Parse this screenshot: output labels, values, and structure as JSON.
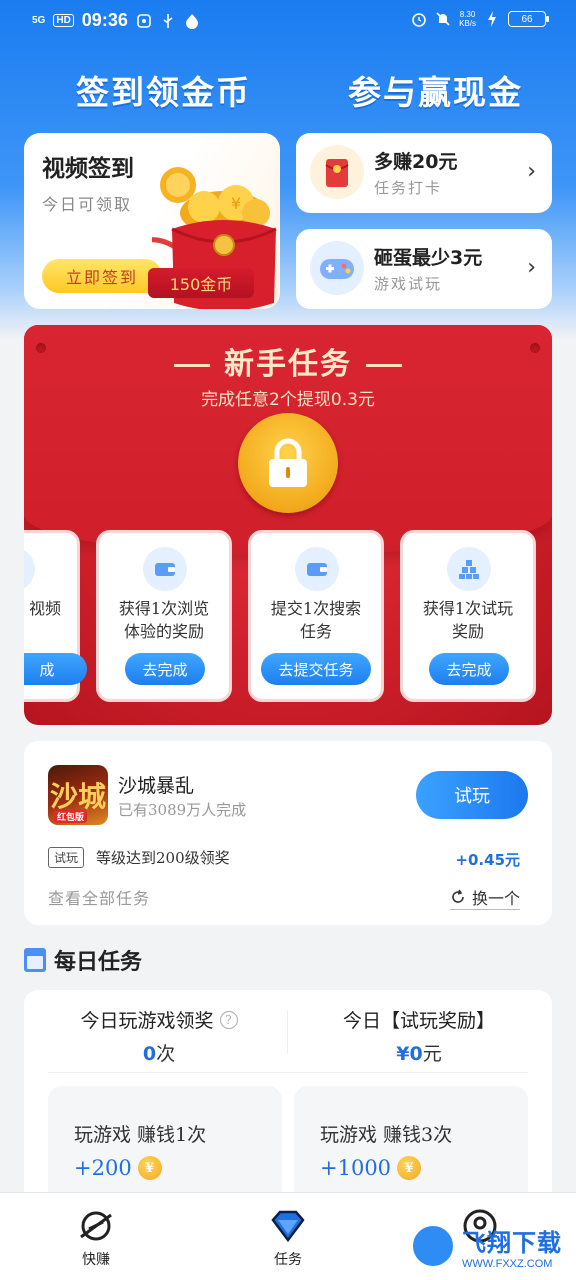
{
  "status_bar": {
    "network": "5G",
    "hd": "HD",
    "time": "09:36",
    "speed_value": "8.30",
    "speed_unit": "KB/s",
    "battery": "66"
  },
  "hero": {
    "left_title": "签到领金币",
    "right_title": "参与赢现金"
  },
  "signin_card": {
    "title": "视频签到",
    "subtitle": "今日可领取",
    "button": "立即签到",
    "badge": "150金币"
  },
  "side_cards": [
    {
      "title": "多赚20元",
      "subtitle": "任务打卡"
    },
    {
      "title": "砸蛋最少3元",
      "subtitle": "游戏试玩"
    }
  ],
  "newbie": {
    "title": "新手任务",
    "subtitle": "完成任意2个提现0.3元",
    "tasks": [
      {
        "line1": "",
        "line2": "视频",
        "button": "成"
      },
      {
        "line1": "获得1次浏览",
        "line2": "体验的奖励",
        "button": "去完成"
      },
      {
        "line1": "提交1次搜索",
        "line2": "任务",
        "button": "去提交任务"
      },
      {
        "line1": "获得1次试玩",
        "line2": "奖励",
        "button": "去完成"
      }
    ]
  },
  "game": {
    "icon_text": "沙城",
    "icon_tag": "红包版",
    "name": "沙城暴乱",
    "completed": "已有3089万人完成",
    "try_button": "试玩",
    "trial_tag": "试玩",
    "trial_desc": "等级达到200级领奖",
    "trial_reward": "+0.45元",
    "view_all": "查看全部任务",
    "swap": "换一个"
  },
  "daily": {
    "title": "每日任务",
    "stat_left_label": "今日玩游戏领奖",
    "stat_left_value": "0",
    "stat_left_unit": "次",
    "stat_right_label": "今日【试玩奖励】",
    "stat_right_value": "¥0",
    "stat_right_unit": "元",
    "items": [
      {
        "title": "玩游戏 赚钱1次",
        "reward": "+200"
      },
      {
        "title": "玩游戏 赚钱3次",
        "reward": "+1000"
      }
    ]
  },
  "tabbar": {
    "tabs": [
      {
        "label": "快赚",
        "icon": "planet-icon"
      },
      {
        "label": "任务",
        "icon": "diamond-icon"
      },
      {
        "label": "",
        "icon": "profile-icon"
      }
    ]
  },
  "watermark": {
    "text": "飞翔下载",
    "url": "WWW.FXXZ.COM"
  },
  "colors": {
    "primary": "#1f6fe0",
    "header_top": "#1a7cf0",
    "newbie_red": "#cc1f2a",
    "gold": "#f5a623"
  }
}
